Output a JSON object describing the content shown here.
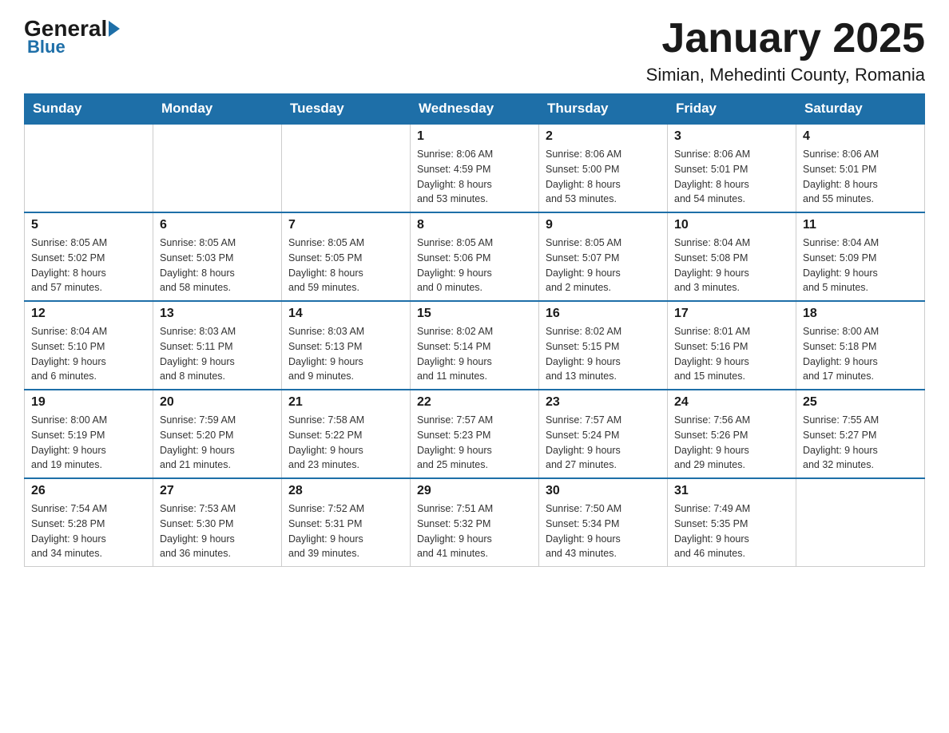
{
  "logo": {
    "general": "General",
    "blue": "Blue"
  },
  "title": "January 2025",
  "subtitle": "Simian, Mehedinti County, Romania",
  "days_of_week": [
    "Sunday",
    "Monday",
    "Tuesday",
    "Wednesday",
    "Thursday",
    "Friday",
    "Saturday"
  ],
  "weeks": [
    [
      {
        "day": "",
        "info": ""
      },
      {
        "day": "",
        "info": ""
      },
      {
        "day": "",
        "info": ""
      },
      {
        "day": "1",
        "info": "Sunrise: 8:06 AM\nSunset: 4:59 PM\nDaylight: 8 hours\nand 53 minutes."
      },
      {
        "day": "2",
        "info": "Sunrise: 8:06 AM\nSunset: 5:00 PM\nDaylight: 8 hours\nand 53 minutes."
      },
      {
        "day": "3",
        "info": "Sunrise: 8:06 AM\nSunset: 5:01 PM\nDaylight: 8 hours\nand 54 minutes."
      },
      {
        "day": "4",
        "info": "Sunrise: 8:06 AM\nSunset: 5:01 PM\nDaylight: 8 hours\nand 55 minutes."
      }
    ],
    [
      {
        "day": "5",
        "info": "Sunrise: 8:05 AM\nSunset: 5:02 PM\nDaylight: 8 hours\nand 57 minutes."
      },
      {
        "day": "6",
        "info": "Sunrise: 8:05 AM\nSunset: 5:03 PM\nDaylight: 8 hours\nand 58 minutes."
      },
      {
        "day": "7",
        "info": "Sunrise: 8:05 AM\nSunset: 5:05 PM\nDaylight: 8 hours\nand 59 minutes."
      },
      {
        "day": "8",
        "info": "Sunrise: 8:05 AM\nSunset: 5:06 PM\nDaylight: 9 hours\nand 0 minutes."
      },
      {
        "day": "9",
        "info": "Sunrise: 8:05 AM\nSunset: 5:07 PM\nDaylight: 9 hours\nand 2 minutes."
      },
      {
        "day": "10",
        "info": "Sunrise: 8:04 AM\nSunset: 5:08 PM\nDaylight: 9 hours\nand 3 minutes."
      },
      {
        "day": "11",
        "info": "Sunrise: 8:04 AM\nSunset: 5:09 PM\nDaylight: 9 hours\nand 5 minutes."
      }
    ],
    [
      {
        "day": "12",
        "info": "Sunrise: 8:04 AM\nSunset: 5:10 PM\nDaylight: 9 hours\nand 6 minutes."
      },
      {
        "day": "13",
        "info": "Sunrise: 8:03 AM\nSunset: 5:11 PM\nDaylight: 9 hours\nand 8 minutes."
      },
      {
        "day": "14",
        "info": "Sunrise: 8:03 AM\nSunset: 5:13 PM\nDaylight: 9 hours\nand 9 minutes."
      },
      {
        "day": "15",
        "info": "Sunrise: 8:02 AM\nSunset: 5:14 PM\nDaylight: 9 hours\nand 11 minutes."
      },
      {
        "day": "16",
        "info": "Sunrise: 8:02 AM\nSunset: 5:15 PM\nDaylight: 9 hours\nand 13 minutes."
      },
      {
        "day": "17",
        "info": "Sunrise: 8:01 AM\nSunset: 5:16 PM\nDaylight: 9 hours\nand 15 minutes."
      },
      {
        "day": "18",
        "info": "Sunrise: 8:00 AM\nSunset: 5:18 PM\nDaylight: 9 hours\nand 17 minutes."
      }
    ],
    [
      {
        "day": "19",
        "info": "Sunrise: 8:00 AM\nSunset: 5:19 PM\nDaylight: 9 hours\nand 19 minutes."
      },
      {
        "day": "20",
        "info": "Sunrise: 7:59 AM\nSunset: 5:20 PM\nDaylight: 9 hours\nand 21 minutes."
      },
      {
        "day": "21",
        "info": "Sunrise: 7:58 AM\nSunset: 5:22 PM\nDaylight: 9 hours\nand 23 minutes."
      },
      {
        "day": "22",
        "info": "Sunrise: 7:57 AM\nSunset: 5:23 PM\nDaylight: 9 hours\nand 25 minutes."
      },
      {
        "day": "23",
        "info": "Sunrise: 7:57 AM\nSunset: 5:24 PM\nDaylight: 9 hours\nand 27 minutes."
      },
      {
        "day": "24",
        "info": "Sunrise: 7:56 AM\nSunset: 5:26 PM\nDaylight: 9 hours\nand 29 minutes."
      },
      {
        "day": "25",
        "info": "Sunrise: 7:55 AM\nSunset: 5:27 PM\nDaylight: 9 hours\nand 32 minutes."
      }
    ],
    [
      {
        "day": "26",
        "info": "Sunrise: 7:54 AM\nSunset: 5:28 PM\nDaylight: 9 hours\nand 34 minutes."
      },
      {
        "day": "27",
        "info": "Sunrise: 7:53 AM\nSunset: 5:30 PM\nDaylight: 9 hours\nand 36 minutes."
      },
      {
        "day": "28",
        "info": "Sunrise: 7:52 AM\nSunset: 5:31 PM\nDaylight: 9 hours\nand 39 minutes."
      },
      {
        "day": "29",
        "info": "Sunrise: 7:51 AM\nSunset: 5:32 PM\nDaylight: 9 hours\nand 41 minutes."
      },
      {
        "day": "30",
        "info": "Sunrise: 7:50 AM\nSunset: 5:34 PM\nDaylight: 9 hours\nand 43 minutes."
      },
      {
        "day": "31",
        "info": "Sunrise: 7:49 AM\nSunset: 5:35 PM\nDaylight: 9 hours\nand 46 minutes."
      },
      {
        "day": "",
        "info": ""
      }
    ]
  ]
}
